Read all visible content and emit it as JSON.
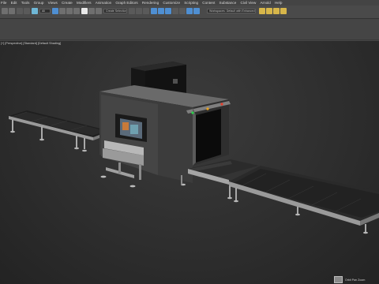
{
  "app": {
    "title": "3ds Max"
  },
  "menu": [
    {
      "label": "File"
    },
    {
      "label": "Edit"
    },
    {
      "label": "Tools"
    },
    {
      "label": "Group"
    },
    {
      "label": "Views"
    },
    {
      "label": "Create"
    },
    {
      "label": "Modifiers"
    },
    {
      "label": "Animation"
    },
    {
      "label": "Graph Editors"
    },
    {
      "label": "Rendering"
    },
    {
      "label": "Customize"
    },
    {
      "label": "Scripting"
    },
    {
      "label": "Content"
    },
    {
      "label": "Substance"
    },
    {
      "label": "Civil View"
    },
    {
      "label": "Arnold"
    },
    {
      "label": "Help"
    }
  ],
  "toolbar": {
    "selection_filter": "All",
    "named_selection": "Create Selection Set",
    "workspace": "Workspaces: Default with Enhanced Menus"
  },
  "viewport": {
    "label": "[+] [Perspective] [Standard] [Default Shading]",
    "viewcube_label": "Orbit  Pan  Zoom"
  },
  "colors": {
    "background": "#2e2e2e",
    "indicator_green": "#2bd14a",
    "indicator_amber": "#e8a21f",
    "indicator_red": "#e23b2a"
  }
}
